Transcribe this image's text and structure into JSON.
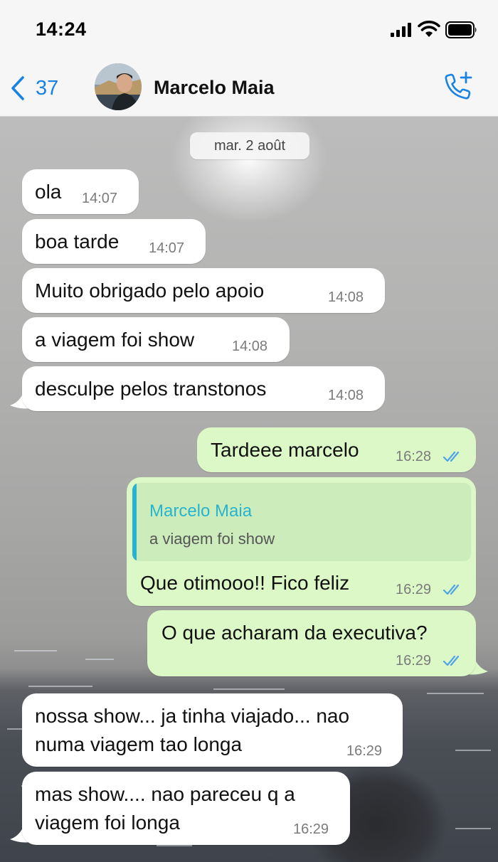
{
  "status_bar": {
    "time": "14:24"
  },
  "header": {
    "back_count": "37",
    "contact_name": "Marcelo Maia"
  },
  "chat": {
    "date_label": "mar. 2 août",
    "messages": [
      {
        "text": "ola",
        "time": "14:07"
      },
      {
        "text": "boa tarde",
        "time": "14:07"
      },
      {
        "text": "Muito obrigado pelo apoio",
        "time": "14:08"
      },
      {
        "text": "a viagem foi show",
        "time": "14:08"
      },
      {
        "text": "desculpe pelos transtonos",
        "time": "14:08"
      },
      {
        "text": "Tardeee marcelo",
        "time": "16:28",
        "status": "read"
      },
      {
        "quote_author": "Marcelo Maia",
        "quote_text": "a viagem foi show",
        "text": "Que otimooo!! Fico feliz",
        "time": "16:29",
        "status": "read"
      },
      {
        "text": "O que acharam da executiva?",
        "time": "16:29",
        "status": "read"
      },
      {
        "line1": "nossa show... ja tinha viajado... nao",
        "line2": "numa viagem tao longa",
        "time": "16:29"
      },
      {
        "line1": "mas show.... nao pareceu q a",
        "line2": "viagem foi longa",
        "time": "16:29"
      }
    ]
  },
  "colors": {
    "accent": "#1a82e2",
    "outgoing_bubble": "#dcf8c6",
    "incoming_bubble": "#ffffff",
    "read_ticks": "#4fa3e8",
    "quote_accent": "#28b4cd"
  }
}
